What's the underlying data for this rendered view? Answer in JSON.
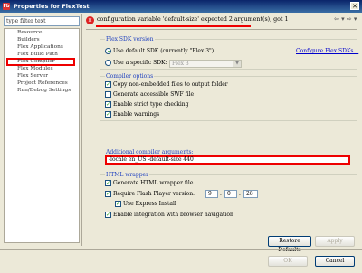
{
  "window": {
    "title": "Properties for FlexTest",
    "icon_letter": "Fb",
    "close_glyph": "✕"
  },
  "filter": {
    "placeholder": "type filter text"
  },
  "tree": {
    "items": [
      "Resource",
      "Builders",
      "Flex Applications",
      "Flex Build Path",
      "Flex Compiler",
      "Flex Modules",
      "Flex Server",
      "Project References",
      "Run/Debug Settings"
    ],
    "selected": "Flex Compiler"
  },
  "header": {
    "error_glyph": "×",
    "message": "configuration variable 'default-size' expected 2 argument(s), got 1",
    "nav": "⇦ ▾ ⇨ ▾"
  },
  "sdk": {
    "group_label": "Flex SDK version",
    "default_label": "Use default SDK (currently \"Flex 3\")",
    "specific_label": "Use a specific SDK:",
    "specific_value": "Flex 3",
    "configure_link": "Configure Flex SDKs..."
  },
  "compiler": {
    "group_label": "Compiler options",
    "copy_label": "Copy non-embedded files to output folder",
    "accessible_label": "Generate accessible SWF file",
    "strict_label": "Enable strict type checking",
    "warnings_label": "Enable warnings"
  },
  "additional": {
    "label": "Additional compiler arguments:",
    "value": "-locale en_US -default-size 440"
  },
  "html": {
    "group_label": "HTML wrapper",
    "generate_label": "Generate HTML wrapper file",
    "require_label": "Require Flash Player version:",
    "ver_major": "9",
    "ver_minor": "0",
    "ver_rev": "28",
    "express_label": "Use Express Install",
    "browser_label": "Enable integration with browser navigation"
  },
  "buttons": {
    "restore": "Restore Defaults",
    "apply": "Apply",
    "ok": "OK",
    "cancel": "Cancel"
  },
  "colors": {
    "highlight": "#e00000",
    "title_bar": "#0a246a",
    "link": "#0000cc"
  }
}
